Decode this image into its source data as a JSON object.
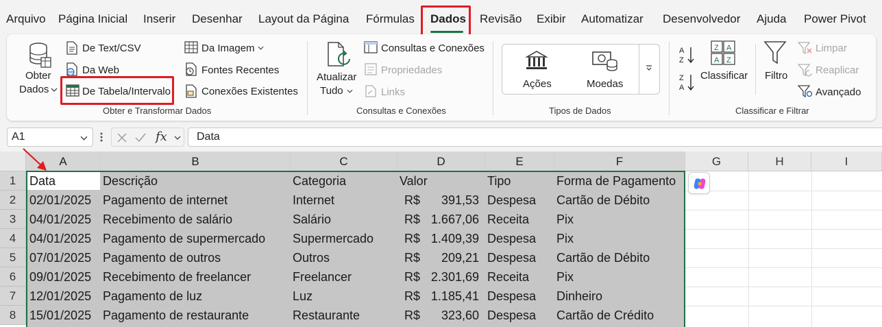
{
  "menu": {
    "tabs": [
      {
        "label": "Arquivo"
      },
      {
        "label": "Página Inicial"
      },
      {
        "label": "Inserir"
      },
      {
        "label": "Desenhar"
      },
      {
        "label": "Layout da Página"
      },
      {
        "label": "Fórmulas"
      },
      {
        "label": "Dados"
      },
      {
        "label": "Revisão"
      },
      {
        "label": "Exibir"
      },
      {
        "label": "Automatizar"
      },
      {
        "label": "Desenvolvedor"
      },
      {
        "label": "Ajuda"
      },
      {
        "label": "Power Pivot"
      }
    ],
    "active_tab": "Dados"
  },
  "ribbon": {
    "get_transform": {
      "obter_line1": "Obter",
      "obter_line2": "Dados",
      "text_csv": "De Text/CSV",
      "web": "Da Web",
      "tabela": "De Tabela/Intervalo",
      "imagem": "Da Imagem",
      "fontes": "Fontes Recentes",
      "conexoes": "Conexões Existentes",
      "label": "Obter e Transformar Dados"
    },
    "queries": {
      "atualizar_line1": "Atualizar",
      "atualizar_line2": "Tudo",
      "consultas": "Consultas e Conexões",
      "propriedades": "Propriedades",
      "links": "Links",
      "label": "Consultas e Conexões"
    },
    "data_types": {
      "acoes": "Ações",
      "moedas": "Moedas",
      "label": "Tipos de Dados"
    },
    "sort_filter": {
      "classificar": "Classificar",
      "filtro": "Filtro",
      "limpar": "Limpar",
      "reaplicar": "Reaplicar",
      "avancado": "Avançado",
      "label": "Classificar e Filtrar"
    }
  },
  "formula_bar": {
    "cell_ref": "A1",
    "fx": "fx",
    "content": "Data"
  },
  "sheet": {
    "columns": [
      "A",
      "B",
      "C",
      "D",
      "E",
      "F",
      "G",
      "H",
      "I"
    ],
    "rows": [
      "1",
      "2",
      "3",
      "4",
      "5",
      "6",
      "7",
      "8"
    ],
    "headers": [
      "Data",
      "Descrição",
      "Categoria",
      "Valor",
      "Tipo",
      "Forma de Pagamento"
    ],
    "currency": "R$",
    "data": [
      [
        "02/01/2025",
        "Pagamento de internet",
        "Internet",
        "391,53",
        "Despesa",
        "Cartão de Débito"
      ],
      [
        "04/01/2025",
        "Recebimento de salário",
        "Salário",
        "1.667,06",
        "Receita",
        "Pix"
      ],
      [
        "04/01/2025",
        "Pagamento de supermercado",
        "Supermercado",
        "1.409,39",
        "Despesa",
        "Pix"
      ],
      [
        "07/01/2025",
        "Pagamento de outros",
        "Outros",
        "209,21",
        "Despesa",
        "Cartão de Débito"
      ],
      [
        "09/01/2025",
        "Recebimento de freelancer",
        "Freelancer",
        "2.301,69",
        "Receita",
        "Pix"
      ],
      [
        "12/01/2025",
        "Pagamento de luz",
        "Luz",
        "1.185,41",
        "Despesa",
        "Dinheiro"
      ],
      [
        "15/01/2025",
        "Pagamento de restaurante",
        "Restaurante",
        "323,60",
        "Despesa",
        "Cartão de Crédito"
      ]
    ]
  },
  "colors": {
    "accent": "#1e7145",
    "highlight": "#e01b22",
    "selection": "#c6c6c6"
  },
  "icons": [
    "database-icon",
    "text-file-icon",
    "web-icon",
    "table-icon",
    "image-icon",
    "recent-sources-icon",
    "existing-connections-icon",
    "refresh-icon",
    "queries-icon",
    "properties-icon",
    "links-icon",
    "bank-icon",
    "currency-icon",
    "sort-az-icon",
    "sort-za-icon",
    "sort-icon",
    "filter-icon",
    "clear-filter-icon",
    "reapply-icon",
    "advanced-filter-icon",
    "copilot-icon",
    "red-arrow-icon"
  ]
}
